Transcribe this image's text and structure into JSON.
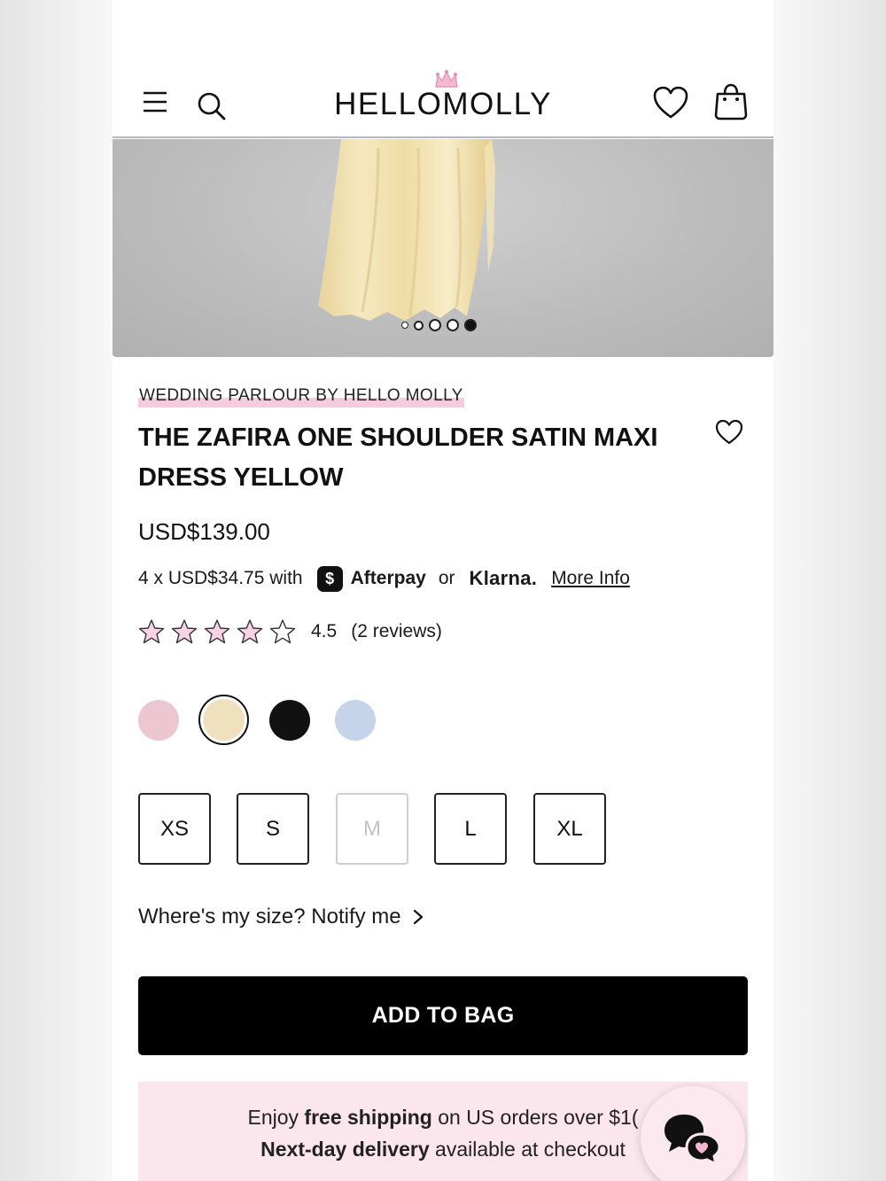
{
  "header": {
    "logo_text": "HELLOMOLLY"
  },
  "carousel": {
    "slide_count": 5,
    "active_index": 4
  },
  "product": {
    "brand": "WEDDING PARLOUR BY HELLO MOLLY",
    "title": "THE ZAFIRA ONE SHOULDER SATIN MAXI DRESS YELLOW",
    "price": "USD$139.00",
    "installments_text": "4 x USD$34.75 with",
    "afterpay_badge": "$",
    "afterpay_label": "Afterpay",
    "or_text": "or",
    "klarna_label": "Klarna.",
    "more_info_label": "More Info",
    "rating_value": "4.5",
    "review_count": "(2 reviews)",
    "rating_stars": 5
  },
  "colors": [
    {
      "name": "pink",
      "hex": "#ecc7d2",
      "selected": false
    },
    {
      "name": "cream",
      "hex": "#efe1bd",
      "selected": true
    },
    {
      "name": "black",
      "hex": "#111111",
      "selected": false
    },
    {
      "name": "blue",
      "hex": "#c5d4eb",
      "selected": false
    }
  ],
  "sizes": [
    {
      "label": "XS",
      "available": true
    },
    {
      "label": "S",
      "available": true
    },
    {
      "label": "M",
      "available": false
    },
    {
      "label": "L",
      "available": true
    },
    {
      "label": "XL",
      "available": true
    }
  ],
  "notify": {
    "label": "Where's my size? Notify me"
  },
  "actions": {
    "add_to_bag_label": "ADD TO BAG"
  },
  "shipping": {
    "line1_prefix": "Enjoy ",
    "line1_bold": "free shipping",
    "line1_suffix": " on US orders over $1(",
    "line2_bold": "Next-day delivery",
    "line2_suffix": " available at checkout"
  },
  "theme": {
    "accent_pink": "#f6cbe0",
    "banner_pink": "#fbe6ee",
    "button_black": "#000000"
  },
  "icons": {
    "menu": "menu-icon",
    "search": "search-icon",
    "wishlist": "heart-icon",
    "bag": "shopping-bag-icon",
    "chat": "chat-icon",
    "star": "star-icon"
  }
}
